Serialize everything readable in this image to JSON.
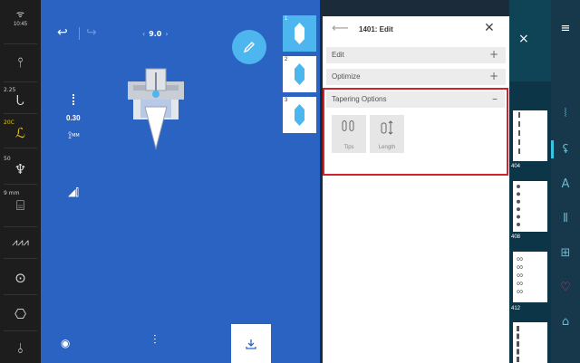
{
  "status": {
    "clock": "10:45",
    "stitch_length": "2.25",
    "tension": "20C",
    "presser_pressure": "50",
    "presser_height": "9 mm"
  },
  "main": {
    "stitch_width": "9.0",
    "left_value": "0.30",
    "unit_label": "MM"
  },
  "thumbnails": [
    "1",
    "2",
    "3"
  ],
  "panel": {
    "title": "1401: Edit",
    "sections": [
      {
        "label": "Edit",
        "sign": "+"
      },
      {
        "label": "Optimize",
        "sign": "+"
      },
      {
        "label": "Tapering Options",
        "sign": "–"
      }
    ],
    "options": [
      {
        "label": "Tips",
        "icon": "tips-icon"
      },
      {
        "label": "Length",
        "icon": "length-icon"
      }
    ]
  },
  "library": {
    "stitch_numbers": [
      "404",
      "408",
      "412"
    ]
  },
  "colors": {
    "main_blue": "#2b63c3",
    "accent_cyan": "#4db6ef",
    "highlight_red": "#d0232a",
    "right_nav_bg": "#16384a"
  }
}
